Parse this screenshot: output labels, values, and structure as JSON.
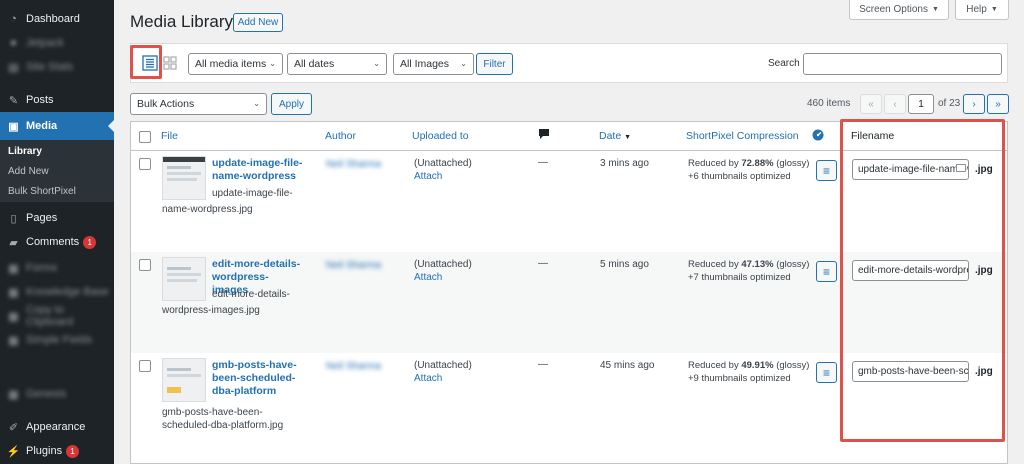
{
  "sidebar": {
    "items": [
      {
        "label": "Dashboard",
        "icon": "dashboard-icon",
        "glyph": "◔"
      },
      {
        "label": "Jetpack",
        "icon": "jetpack-icon",
        "glyph": "●"
      },
      {
        "label": "Site Stats",
        "icon": "stats-icon",
        "glyph": "▤"
      },
      {
        "label": "Posts",
        "icon": "pin-icon",
        "glyph": "✎"
      },
      {
        "label": "Media",
        "icon": "media-icon",
        "glyph": "▣"
      },
      {
        "label": "Pages",
        "icon": "pages-icon",
        "glyph": "▯"
      },
      {
        "label": "Comments",
        "icon": "comments-icon",
        "glyph": "▰",
        "badge": "1"
      },
      {
        "label": "Forms",
        "icon": "forms-icon",
        "glyph": "▦"
      },
      {
        "label": "Knowledge Base",
        "icon": "knowledge-icon",
        "glyph": "▦"
      },
      {
        "label": "Copy to Clipboard",
        "icon": "clipboard-icon",
        "glyph": "▦"
      },
      {
        "label": "Simple Fields",
        "icon": "fields-icon",
        "glyph": "▦"
      },
      {
        "label": "Genesis",
        "icon": "genesis-icon",
        "glyph": "▦"
      },
      {
        "label": "Appearance",
        "icon": "brush-icon",
        "glyph": "✐"
      },
      {
        "label": "Plugins",
        "icon": "plugin-icon",
        "glyph": "⚡",
        "badge": "1"
      }
    ],
    "submenu": [
      "Library",
      "Add New",
      "Bulk ShortPixel"
    ]
  },
  "top_buttons": {
    "screen_options": "Screen Options",
    "help": "Help"
  },
  "header": {
    "title": "Media Library",
    "add_new": "Add New"
  },
  "filters": {
    "media_type": "All media items",
    "dates": "All dates",
    "images": "All Images",
    "filter_button": "Filter",
    "search_label": "Search",
    "search_value": ""
  },
  "bulk": {
    "selected": "Bulk Actions",
    "apply": "Apply"
  },
  "pagination": {
    "items": "460 items",
    "first": "«",
    "prev": "‹",
    "current": "1",
    "of": "of 23",
    "next": "›",
    "last": "»"
  },
  "table": {
    "columns": {
      "file": "File",
      "author": "Author",
      "uploaded_to": "Uploaded to",
      "date": "Date",
      "date_sort": "▼",
      "shortpixel": "ShortPixel Compression",
      "filename": "Filename"
    },
    "rows": [
      {
        "title_lines": [
          "update-image-file-",
          "name-wordpress"
        ],
        "filename_lines": [
          "update-image-file-",
          "name-wordpress.jpg"
        ],
        "author": "Neil Sharma",
        "uploaded": "(Unattached)",
        "attach": "Attach",
        "comments": "—",
        "date": "3 mins ago",
        "sp_prefix": "Reduced by ",
        "sp_pct": "72.88%",
        "sp_suffix": " (glossy)",
        "sp_thumbs": "+6 thumbnails optimized",
        "menu_glyph": "≡",
        "filename_value": "update-image-file-name-wordpress",
        "ext": ".jpg"
      },
      {
        "title_lines": [
          "edit-more-details-",
          "wordpress-images"
        ],
        "filename_lines": [
          "edit-more-details-",
          "wordpress-images.jpg"
        ],
        "author": "Neil Sharma",
        "uploaded": "(Unattached)",
        "attach": "Attach",
        "comments": "—",
        "date": "5 mins ago",
        "sp_prefix": "Reduced by ",
        "sp_pct": "47.13%",
        "sp_suffix": " (glossy)",
        "sp_thumbs": "+7 thumbnails optimized",
        "menu_glyph": "≡",
        "filename_value": "edit-more-details-wordpress-images",
        "ext": ".jpg"
      },
      {
        "title_lines": [
          "gmb-posts-have-",
          "been-scheduled-",
          "dba-platform"
        ],
        "filename_lines": [
          "gmb-posts-have-been-",
          "scheduled-dba-platform.jpg"
        ],
        "author": "Neil Sharma",
        "uploaded": "(Unattached)",
        "attach": "Attach",
        "comments": "—",
        "date": "45 mins ago",
        "sp_prefix": "Reduced by ",
        "sp_pct": "49.91%",
        "sp_suffix": " (glossy)",
        "sp_thumbs": "+9 thumbnails optimized",
        "menu_glyph": "≡",
        "filename_value": "gmb-posts-have-been-scheduled-dba-platform",
        "ext": ".jpg"
      }
    ]
  },
  "colors": {
    "accent": "#2271b1",
    "highlight": "#e0514a",
    "sidebar": "#1d2327",
    "badge": "#d63638"
  }
}
